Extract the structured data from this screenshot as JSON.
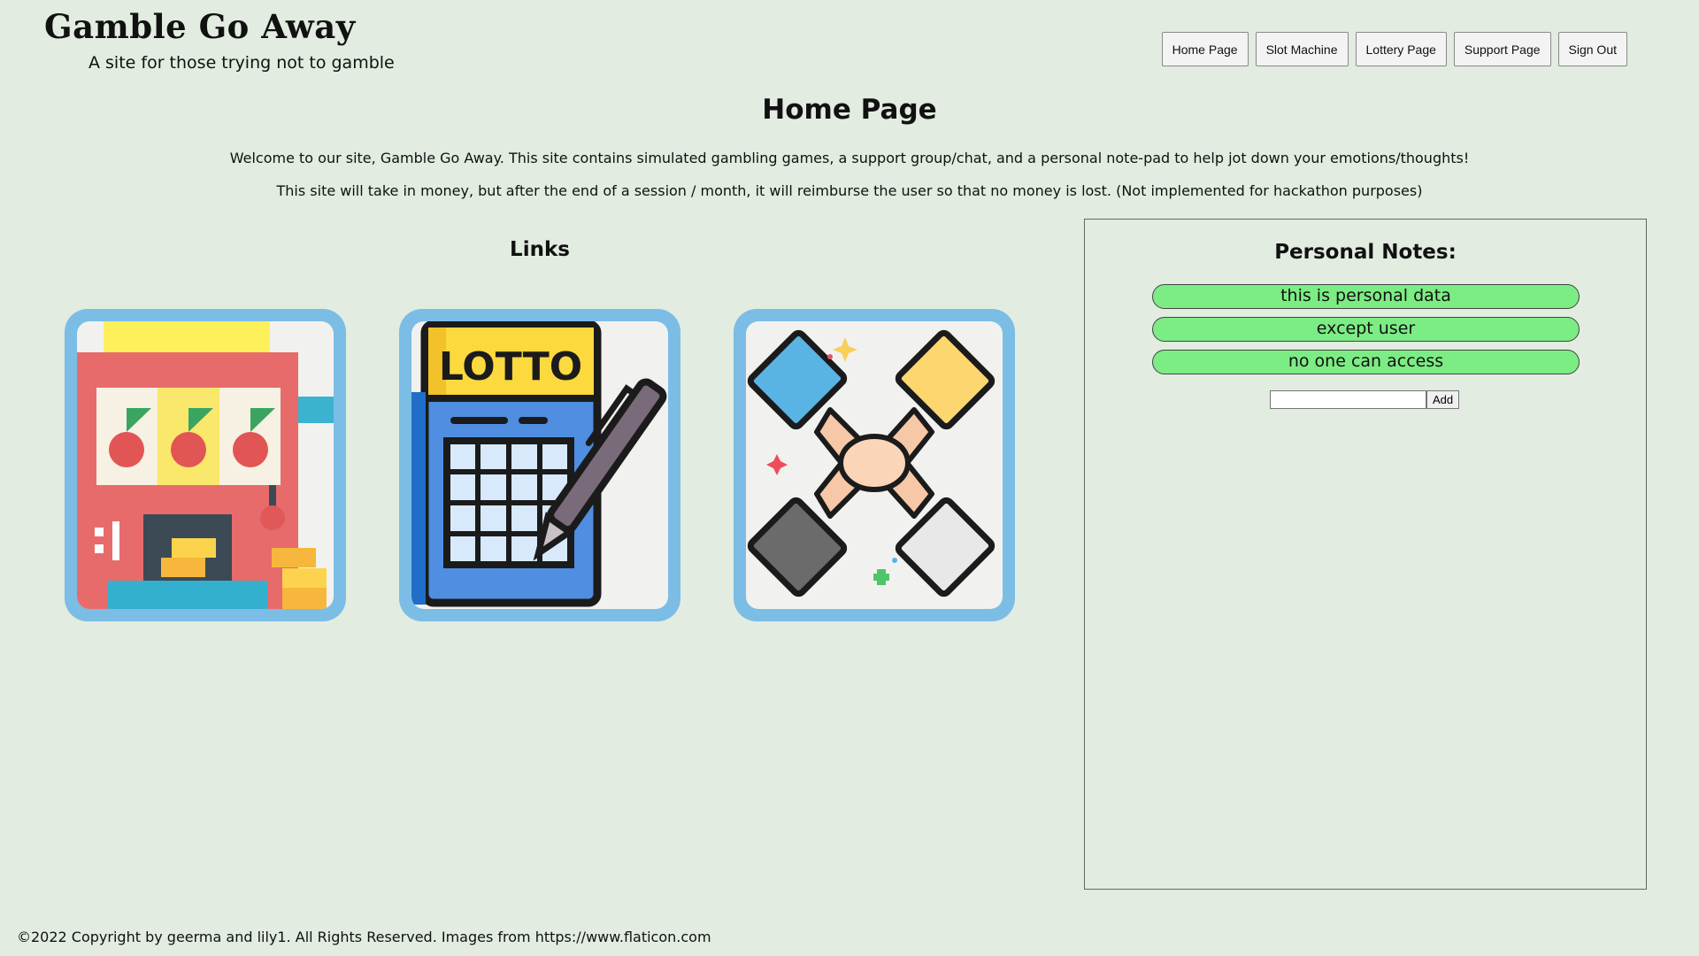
{
  "header": {
    "site_title": "Gamble Go Away",
    "tagline": "A site for those trying not to gamble"
  },
  "nav": {
    "home": "Home Page",
    "slot": "Slot Machine",
    "lottery": "Lottery Page",
    "support": "Support Page",
    "signout": "Sign Out"
  },
  "main": {
    "title": "Home Page",
    "intro_1": "Welcome to our site, Gamble Go Away. This site contains simulated gambling games, a support group/chat, and a personal note-pad to help jot down your emotions/thoughts!",
    "intro_2": "This site will take in money, but after the end of a session / month, it will reimburse the user so that no money is lost. (Not implemented for hackathon purposes)"
  },
  "links": {
    "heading": "Links",
    "cards": [
      {
        "icon": "slot-machine-icon"
      },
      {
        "icon": "lottery-ticket-icon",
        "label": "LOTTO"
      },
      {
        "icon": "support-hands-icon"
      }
    ]
  },
  "notes": {
    "heading": "Personal Notes:",
    "items": [
      "this is personal data",
      "except user",
      "no one can access"
    ],
    "input_value": "",
    "add_label": "Add"
  },
  "footer": {
    "text": "©2022 Copyright by geerma and lily1. All Rights Reserved. Images from https://www.flaticon.com"
  },
  "colors": {
    "background": "#e2ece1",
    "card_border": "#7bbde5",
    "note_fill": "#7cec84"
  }
}
